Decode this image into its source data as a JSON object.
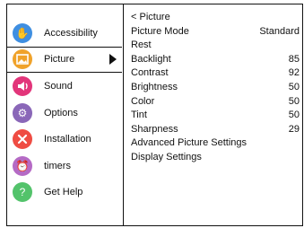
{
  "sidebar": {
    "items": [
      {
        "label": "Accessibility",
        "icon": "hand-icon",
        "color": "#3f8fe1",
        "selected": false
      },
      {
        "label": "Picture",
        "icon": "picture-icon",
        "color": "#f0a22a",
        "selected": true
      },
      {
        "label": "Sound",
        "icon": "speaker-icon",
        "color": "#e2357a",
        "selected": false
      },
      {
        "label": "Options",
        "icon": "gear-icon",
        "color": "#8a67b8",
        "selected": false
      },
      {
        "label": "Installation",
        "icon": "tools-icon",
        "color": "#ef4c43",
        "selected": false
      },
      {
        "label": "timers",
        "icon": "alarm-clock-icon",
        "color": "#b56ac5",
        "selected": false
      },
      {
        "label": "Get Help",
        "icon": "help-icon",
        "color": "#53c36b",
        "selected": false
      }
    ]
  },
  "panel": {
    "back_label": "< Picture",
    "rows": [
      {
        "label": "Picture Mode",
        "value": "Standard"
      },
      {
        "label": "Rest",
        "value": ""
      },
      {
        "label": "Backlight",
        "value": "85"
      },
      {
        "label": "Contrast",
        "value": "92"
      },
      {
        "label": "Brightness",
        "value": "50"
      },
      {
        "label": "Color",
        "value": "50"
      },
      {
        "label": "Tint",
        "value": "50"
      },
      {
        "label": "Sharpness",
        "value": "29"
      },
      {
        "label": "Advanced Picture Settings",
        "value": ""
      },
      {
        "label": "Display Settings",
        "value": ""
      }
    ]
  }
}
